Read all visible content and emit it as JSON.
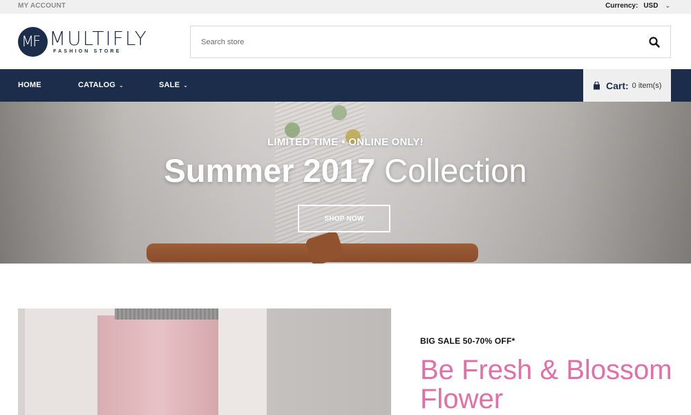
{
  "topbar": {
    "account": "MY ACCOUNT",
    "currency_label": "Currency:",
    "currency_value": "USD"
  },
  "logo": {
    "mark": "MF",
    "name": "MULTIFLY",
    "tagline": "FASHION STORE"
  },
  "search": {
    "placeholder": "Search store"
  },
  "nav": {
    "items": [
      {
        "label": "HOME",
        "has_dropdown": false
      },
      {
        "label": "CATALOG",
        "has_dropdown": true
      },
      {
        "label": "SALE",
        "has_dropdown": true
      }
    ],
    "cart": {
      "label": "Cart:",
      "count": "0 item(s)"
    }
  },
  "hero": {
    "tag_left": "LIMITED TIME",
    "tag_sep": "●",
    "tag_right": "ONLINE ONLY!",
    "title_bold": "Summer 2017",
    "title_light": "Collection",
    "button": "SHOP NOW"
  },
  "promo": {
    "label": "BIG SALE 50-70% OFF*",
    "title": "Be Fresh & Blossom Flower"
  },
  "colors": {
    "navy": "#1b2d4a",
    "pink": "#e26fa7",
    "topbar": "#f0f0f0"
  },
  "icons": {
    "search": "search-icon",
    "cart": "shopping-bag-icon",
    "caret": "chevron-down-icon"
  }
}
